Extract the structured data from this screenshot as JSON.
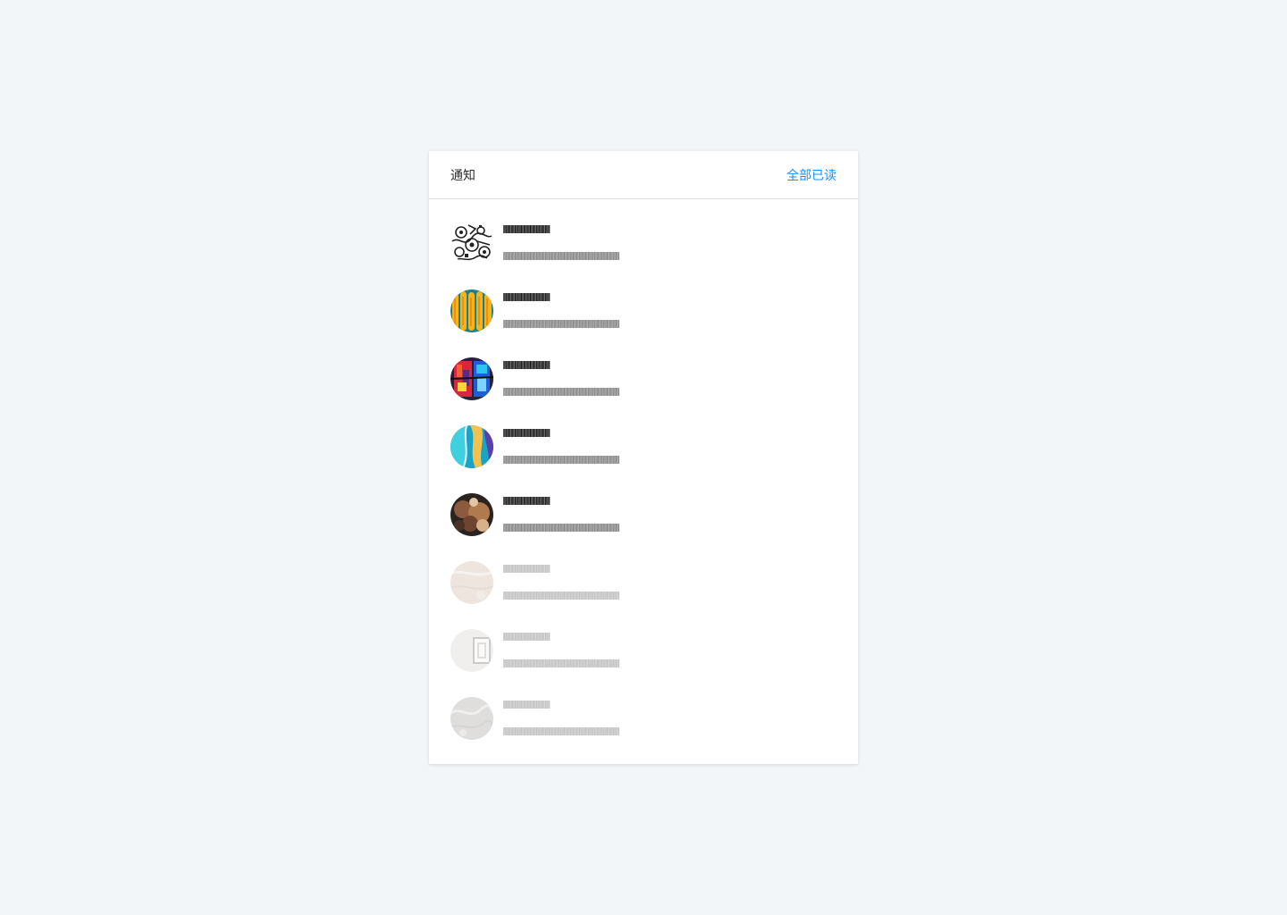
{
  "panel": {
    "title": "通知",
    "mark_all_read": "全部已读"
  },
  "colors": {
    "page_background": "#f2f6f9",
    "accent": "#1890ff",
    "unread_title": "#1f1f1f",
    "unread_description": "#8a8a8a",
    "read_text": "#c4c4c4"
  },
  "notifications": [
    {
      "title": "IIIIIIIIIIIIIIIIIIIIIIIIIIIIIIIIIIIII",
      "description": "IIIIIIIIIIIIIIIIIIIIIIIIIIIIIIIIIIIIIIIIIIIIIIIIIIIIIIIIIIIIIIIIIIIIIIIIIIIIIIIIIIIIIIIIIIII",
      "read": false,
      "avatar": "doodle-pattern"
    },
    {
      "title": "IIIIIIIIIIIIIIIIIIIIIIIIIIIIIIIIIIIII",
      "description": "IIIIIIIIIIIIIIIIIIIIIIIIIIIIIIIIIIIIIIIIIIIIIIIIIIIIIIIIIIIIIIIIIIIIIIIIIIIIIIIIIIIIIIIIIIII",
      "read": false,
      "avatar": "yellow-stripes"
    },
    {
      "title": "IIIIIIIIIIIIIIIIIIIIIIIIIIIIIIIIIIIII",
      "description": "IIIIIIIIIIIIIIIIIIIIIIIIIIIIIIIIIIIIIIIIIIIIIIIIIIIIIIIIIIIIIIIIIIIIIIIIIIIIIIIIIIIIIIIIIIII",
      "read": false,
      "avatar": "colorful-graffiti"
    },
    {
      "title": "IIIIIIIIIIIIIIIIIIIIIIIIIIIIIIIIIIIII",
      "description": "IIIIIIIIIIIIIIIIIIIIIIIIIIIIIIIIIIIIIIIIIIIIIIIIIIIIIIIIIIIIIIIIIIIIIIIIIIIIIIIIIIIIIIIIIIII",
      "read": false,
      "avatar": "blue-paint"
    },
    {
      "title": "IIIIIIIIIIIIIIIIIIIIIIIIIIIIIIIIIIIII",
      "description": "IIIIIIIIIIIIIIIIIIIIIIIIIIIIIIIIIIIIIIIIIIIIIIIIIIIIIIIIIIIIIIIIIIIIIIIIIIIIIIIIIIIIIIIIIIII",
      "read": false,
      "avatar": "brown-texture"
    },
    {
      "title": "IIIIIIIIIIIIIIIIIIIIIIIIIIIIIIIIIIIII",
      "description": "IIIIIIIIIIIIIIIIIIIIIIIIIIIIIIIIIIIIIIIIIIIIIIIIIIIIIIIIIIIIIIIIIIIIIIIIIIIIIIIIIIIIIIIIIIII",
      "read": true,
      "avatar": "beige-marble"
    },
    {
      "title": "IIIIIIIIIIIIIIIIIIIIIIIIIIIIIIIIIIIII",
      "description": "IIIIIIIIIIIIIIIIIIIIIIIIIIIIIIIIIIIIIIIIIIIIIIIIIIIIIIIIIIIIIIIIIIIIIIIIIIIIIIIIIIIIIIIIIIII",
      "read": true,
      "avatar": "frame-sketch"
    },
    {
      "title": "IIIIIIIIIIIIIIIIIIIIIIIIIIIIIIIIIIIII",
      "description": "IIIIIIIIIIIIIIIIIIIIIIIIIIIIIIIIIIIIIIIIIIIIIIIIIIIIIIIIIIIIIIIIIIIIIIIIIIIIIIIIIIIIIIIIIIII",
      "read": true,
      "avatar": "grey-marble"
    }
  ]
}
